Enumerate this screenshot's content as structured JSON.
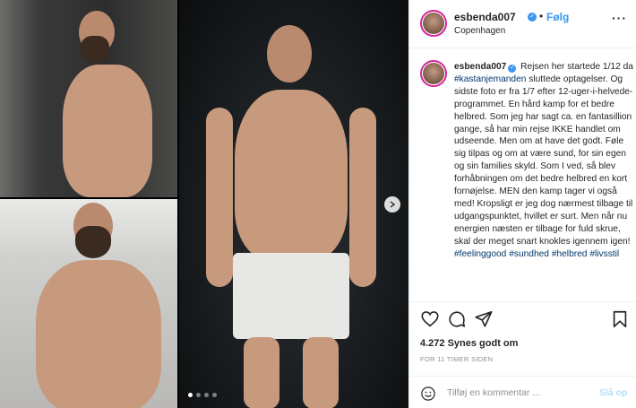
{
  "post": {
    "username": "esbenda007",
    "follow_label": "Følg",
    "dot_separator": "•",
    "location": "Copenhagen",
    "more_icon": "···",
    "caption": {
      "username": "esbenda007",
      "part1": " Rejsen her startede 1/12 da ",
      "tag1": "#kastanjemanden",
      "part2": " sluttede optagelser. Og sidste foto er fra 1/7 efter 12-uger-i-helvede-programmet. En hård kamp for et bedre helbred. Som jeg har sagt ca. en fantasillion gange, så har min rejse IKKE handlet om udseende. Men om at have det godt. Føle sig tilpas og om at være sund, for sin egen og sin families skyld. Som I ved, så blev forhåbningen om det bedre helbred en kort fornøjelse. MEN den kamp tager vi også med! Kropsligt er jeg dog nærmest tilbage til udgangspunktet, hvillet er surt. Men når nu energien næsten er tilbage for fuld skrue, skal der meget snart knokles igennem igen! ",
      "tag2": "#feelinggood",
      "tag3": "#sundhed",
      "tag4": "#helbred",
      "tag5": "#livsstil"
    },
    "likes": "4.272 Synes godt om",
    "timestamp": "FOR 11 TIMER SIDEN",
    "comment_placeholder": "Tilføj en kommentar ...",
    "post_button": "Slå op",
    "carousel": {
      "total": 4,
      "active": 1
    }
  },
  "colors": {
    "accent": "#3897f0",
    "hashtag": "#00376b",
    "muted": "#8e8e8e",
    "post_disabled": "#b2dffc"
  },
  "icons": [
    "heart-icon",
    "comment-icon",
    "share-icon",
    "bookmark-icon",
    "emoji-icon",
    "verified-icon",
    "chevron-right-icon"
  ]
}
